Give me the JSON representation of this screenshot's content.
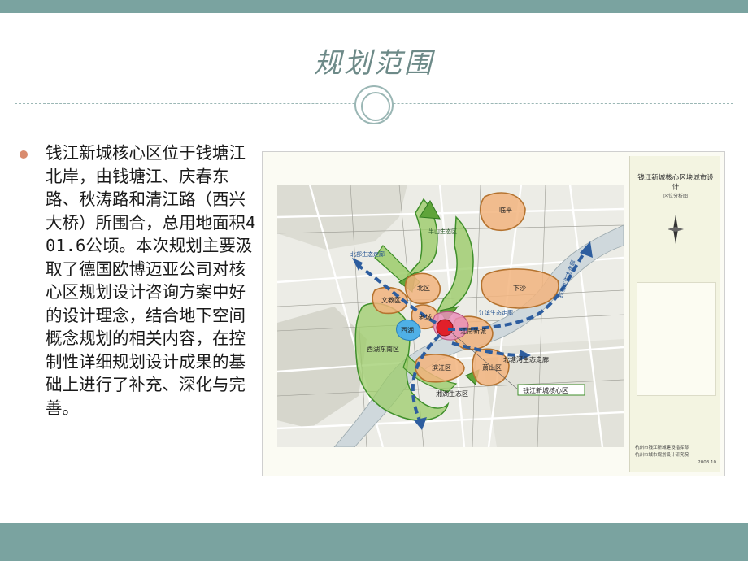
{
  "slide": {
    "title": "规划范围",
    "body": "钱江新城核心区位于钱塘江北岸，由钱塘江、庆春东路、秋涛路和清江路（西兴大桥）所围合，总用地面积401.6公顷。本次规划主要汲取了德国欧博迈亚公司对核心区规划设计咨询方案中好的设计理念，结合地下空间概念规划的相关内容，在控制性详细规划设计成果的基础上进行了补充、深化与完善。"
  },
  "map": {
    "legend_title": "钱江新城核心区块城市设计",
    "legend_subtitle": "区位分析图",
    "footer_lines": [
      "杭州市钱江新城建设指挥部",
      "杭州市城市规划设计研究院"
    ],
    "footer_date": "2003.10",
    "zones": {
      "linping": "临平",
      "xiasha": "下沙",
      "beiqu": "北区",
      "wenjiao": "文教区",
      "laocheng": "老城",
      "xihu": "西湖",
      "jiangnan": "江南新城",
      "xihu_east": "西湖东南区",
      "binjiang": "滨江区",
      "xiaoshan": "萧山区",
      "core": "钱江新城核心区"
    },
    "corridors": {
      "north_mountain": "半山生态区",
      "green_corridor_north": "北部生态走廊",
      "river_corridor": "江滨生态走廊",
      "north_river": "北塘河生态走廊",
      "xianghu": "湘湖生态区",
      "qiantang_corridor": "钱塘江生态走廊"
    },
    "colors": {
      "zone_fill": "#f2b47e",
      "zone_stroke": "#b5732f",
      "green_fill": "#9ccc6a",
      "green_stroke": "#3f8f2a",
      "arrow_blue": "#2d5d9f",
      "core_red": "#e0202a",
      "core_pink": "#e98fb8"
    }
  }
}
